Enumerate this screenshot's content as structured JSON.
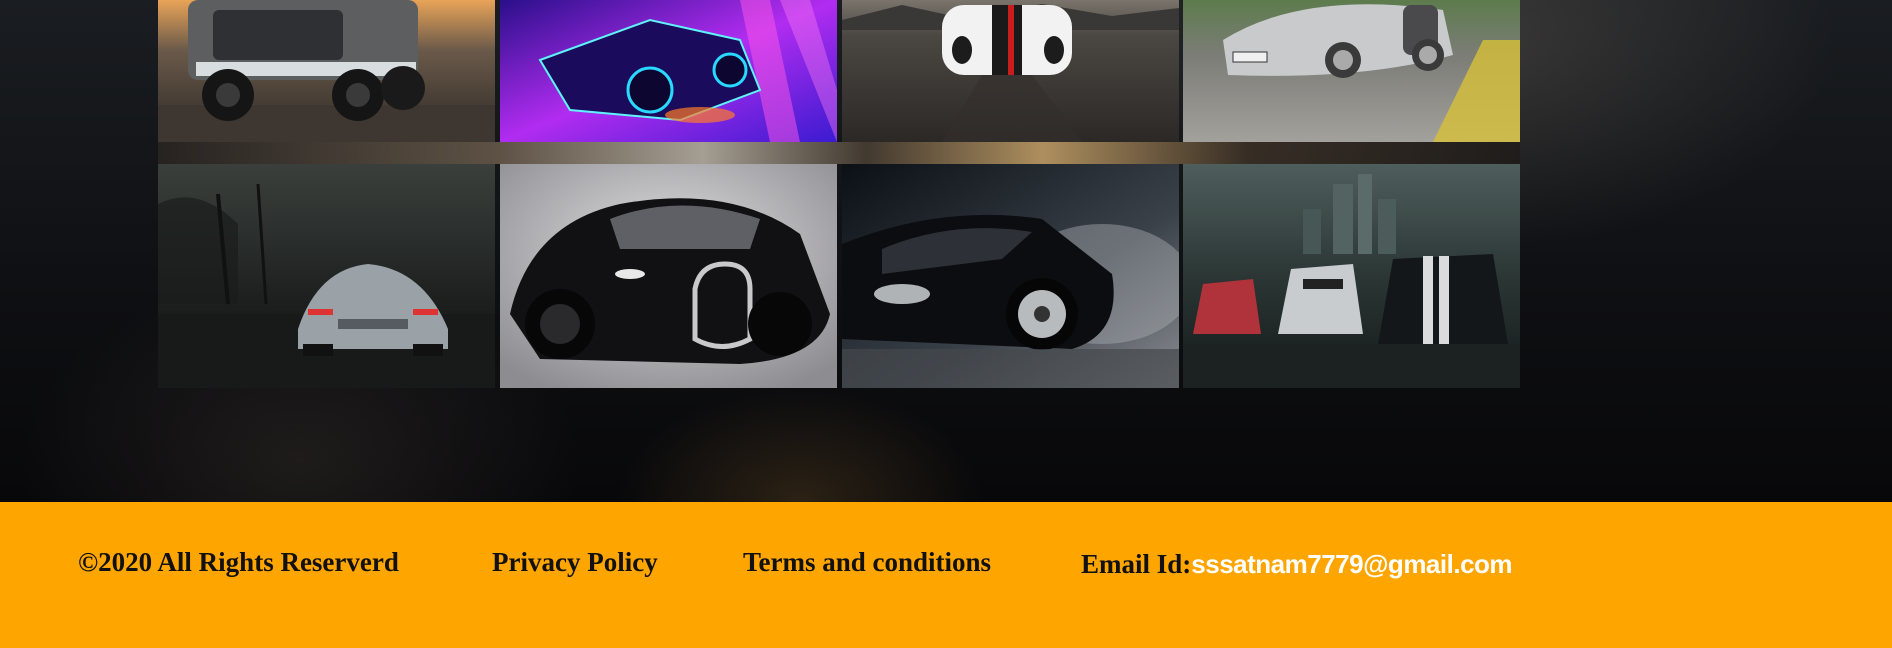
{
  "gallery": {
    "images": [
      {
        "name": "toyota-truck-image",
        "alt": "Gray Toyota pickup truck at sunset"
      },
      {
        "name": "neon-sports-car-image",
        "alt": "Neon-lit sports car illustration"
      },
      {
        "name": "dodge-viper-image",
        "alt": "White and black Dodge Viper on road"
      },
      {
        "name": "audi-r8-image",
        "alt": "Silver Audi R8 on track"
      },
      {
        "name": "mercedes-amg-gt-image",
        "alt": "Silver Mercedes AMG GT in foggy forest"
      },
      {
        "name": "bugatti-veyron-image",
        "alt": "Black Bugatti Veyron"
      },
      {
        "name": "black-sports-car-image",
        "alt": "Black sports car drifting in smoke"
      },
      {
        "name": "muscle-cars-image",
        "alt": "Three muscle cars in stormy city"
      }
    ]
  },
  "footer": {
    "copyright": "©2020 All Rights Reserverd",
    "privacy_policy": "Privacy Policy",
    "terms": "Terms and conditions",
    "email_label": "Email Id:",
    "email_value": "sssatnam7779@gmail.com",
    "background_color": "#ffa500"
  }
}
